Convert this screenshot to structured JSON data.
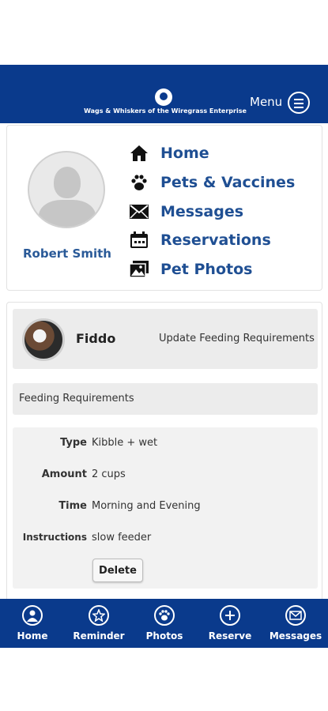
{
  "header": {
    "brand": "Wags & Whiskers of the Wiregrass Enterprise",
    "menu_label": "Menu"
  },
  "profile": {
    "name": "Robert Smith"
  },
  "nav": [
    {
      "label": "Home",
      "icon": "home-icon"
    },
    {
      "label": "Pets & Vaccines",
      "icon": "paw-icon"
    },
    {
      "label": "Messages",
      "icon": "envelope-icon"
    },
    {
      "label": "Reservations",
      "icon": "calendar-icon"
    },
    {
      "label": "Pet Photos",
      "icon": "photos-icon"
    }
  ],
  "pet": {
    "name": "Fiddo",
    "update_link": "Update Feeding Requirements"
  },
  "feeding": {
    "title": "Feeding Requirements",
    "rows": [
      {
        "key": "Type",
        "value": "Kibble + wet"
      },
      {
        "key": "Amount",
        "value": "2 cups"
      },
      {
        "key": "Time",
        "value": "Morning and Evening"
      },
      {
        "key": "Instructions",
        "value": "slow feeder"
      }
    ],
    "delete_label": "Delete"
  },
  "tabbar": [
    {
      "label": "Home",
      "icon": "person-icon"
    },
    {
      "label": "Reminder",
      "icon": "star-icon"
    },
    {
      "label": "Photos",
      "icon": "paw-icon"
    },
    {
      "label": "Reserve",
      "icon": "plus-icon"
    },
    {
      "label": "Messages",
      "icon": "envelope-icon"
    }
  ],
  "colors": {
    "brand": "#0a3a8c",
    "link": "#1f4f93"
  }
}
